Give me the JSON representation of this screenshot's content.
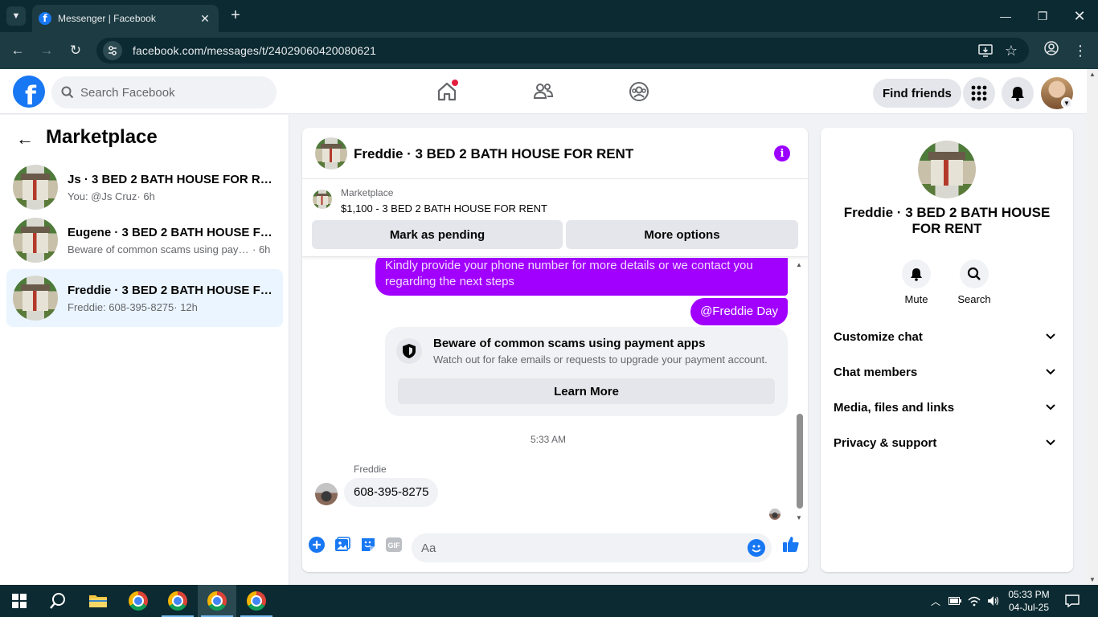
{
  "browser": {
    "tab_title": "Messenger | Facebook",
    "url": "facebook.com/messages/t/24029060420080621"
  },
  "header": {
    "search_placeholder": "Search Facebook",
    "find_friends_label": "Find friends"
  },
  "left": {
    "title": "Marketplace",
    "conversations": [
      {
        "name": "Js · 3 BED 2 BATH HOUSE FOR RENT",
        "snippet": "You: @Js Cruz",
        "time": "· 6h",
        "active": false
      },
      {
        "name": "Eugene · 3 BED 2 BATH HOUSE FOR RENT",
        "snippet": "Beware of common scams using payment apps",
        "time": "· 6h",
        "active": false
      },
      {
        "name": "Freddie · 3 BED 2 BATH HOUSE FOR RENT",
        "snippet": "Freddie: 608-395-8275",
        "time": "· 12h",
        "active": true
      }
    ]
  },
  "chat": {
    "title": "Freddie · 3 BED 2 BATH HOUSE FOR RENT",
    "marketplace_label": "Marketplace",
    "listing": "$1,100 - 3 BED 2 BATH HOUSE FOR RENT",
    "mark_pending_label": "Mark as pending",
    "more_options_label": "More options",
    "messages": {
      "outgoing_1": "Kindly provide your phone number for more details or we contact you regarding the next steps",
      "outgoing_2": "@Freddie Day",
      "scam_title": "Beware of common scams using payment apps",
      "scam_desc": "Watch out for fake emails or requests to upgrade your payment account.",
      "learn_more_label": "Learn More",
      "timestamp": "5:33 AM",
      "sender_name": "Freddie",
      "incoming_1": "608-395-8275"
    },
    "composer_placeholder": "Aa",
    "gif_label": "GIF"
  },
  "info_panel": {
    "name": "Freddie · 3 BED 2 BATH HOUSE FOR RENT",
    "mute_label": "Mute",
    "search_label": "Search",
    "sections": [
      "Customize chat",
      "Chat members",
      "Media, files and links",
      "Privacy & support"
    ]
  },
  "taskbar": {
    "time": "05:33 PM",
    "date": "04-Jul-25"
  },
  "colors": {
    "fb_blue": "#1877f2",
    "outgoing_bubble": "#a100ff",
    "active_conversation": "#ebf5ff"
  }
}
